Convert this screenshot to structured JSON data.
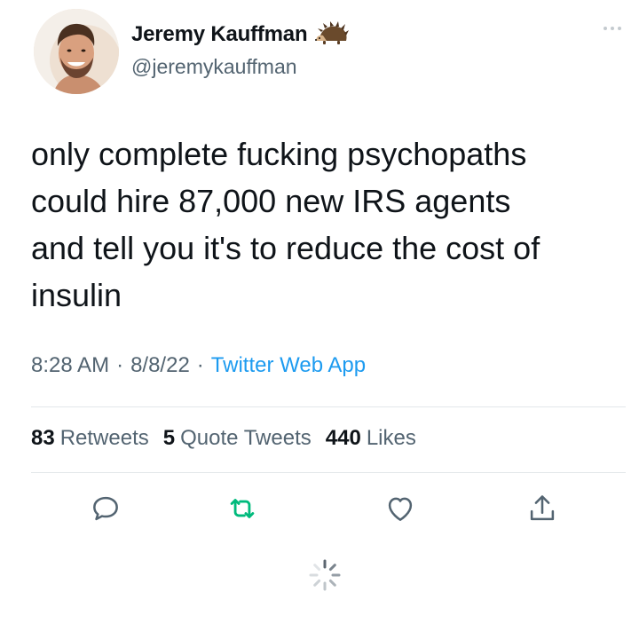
{
  "author": {
    "display_name": "Jeremy Kauffman",
    "handle": "@jeremykauffman",
    "emoji": "hedgehog-emoji"
  },
  "tweet": {
    "text": "only complete fucking psychopaths\ncould hire 87,000 new IRS agents\nand tell you it's to reduce the cost of\ninsulin",
    "time": "8:28 AM",
    "date": "8/8/22",
    "source": "Twitter Web App",
    "separator": "·"
  },
  "stats": {
    "retweets": {
      "count": "83",
      "label": "Retweets"
    },
    "quotes": {
      "count": "5",
      "label": "Quote Tweets"
    },
    "likes": {
      "count": "440",
      "label": "Likes"
    }
  },
  "actions": [
    {
      "name": "reply",
      "icon": "reply-icon"
    },
    {
      "name": "retweet",
      "icon": "retweet-icon",
      "color": "#00ba7c"
    },
    {
      "name": "like",
      "icon": "heart-icon"
    },
    {
      "name": "share",
      "icon": "share-icon"
    }
  ],
  "colors": {
    "text": "#0f1419",
    "secondary": "#536471",
    "link": "#1d9bf0",
    "retweet_active": "#00ba7c",
    "divider": "#e3e7ea"
  },
  "loading": {
    "icon": "loading-spinner-icon"
  }
}
